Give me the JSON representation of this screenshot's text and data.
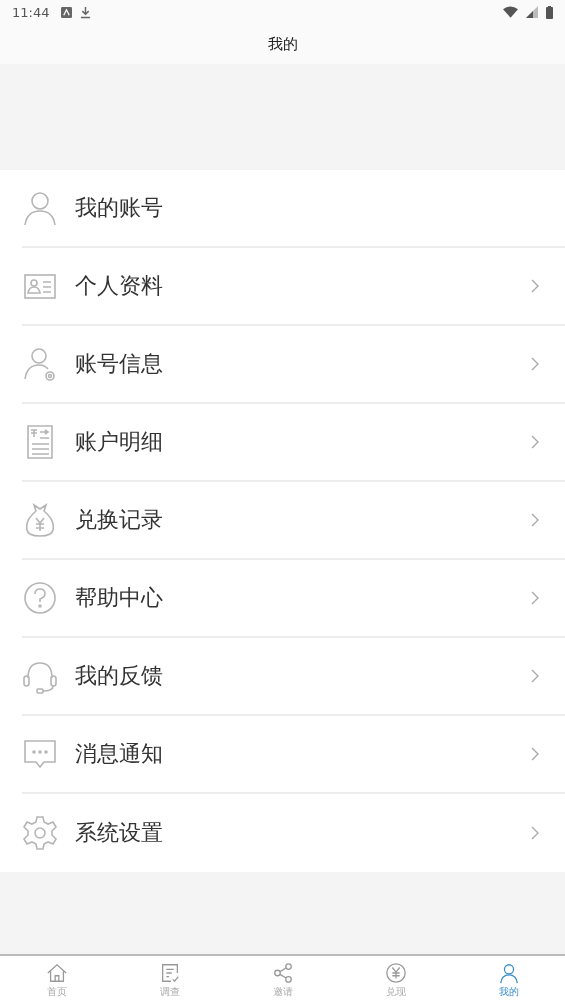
{
  "status_bar": {
    "time": "11:44"
  },
  "title": "我的",
  "menu": [
    {
      "kind": "user",
      "label": "我的账号",
      "chevron": false
    },
    {
      "kind": "card",
      "label": "个人资料",
      "chevron": true
    },
    {
      "kind": "usergear",
      "label": "账号信息",
      "chevron": true
    },
    {
      "kind": "ledger",
      "label": "账户明细",
      "chevron": true
    },
    {
      "kind": "moneybag",
      "label": "兑换记录",
      "chevron": true
    },
    {
      "kind": "help",
      "label": "帮助中心",
      "chevron": true
    },
    {
      "kind": "headset",
      "label": "我的反馈",
      "chevron": true
    },
    {
      "kind": "chat",
      "label": "消息通知",
      "chevron": true
    },
    {
      "kind": "gear",
      "label": "系统设置",
      "chevron": true
    }
  ],
  "nav": [
    {
      "kind": "home",
      "label": "首页",
      "selected": false
    },
    {
      "kind": "survey",
      "label": "调查",
      "selected": false
    },
    {
      "kind": "share",
      "label": "邀请",
      "selected": false
    },
    {
      "kind": "yen",
      "label": "兑现",
      "selected": false
    },
    {
      "kind": "user",
      "label": "我的",
      "selected": true
    }
  ]
}
